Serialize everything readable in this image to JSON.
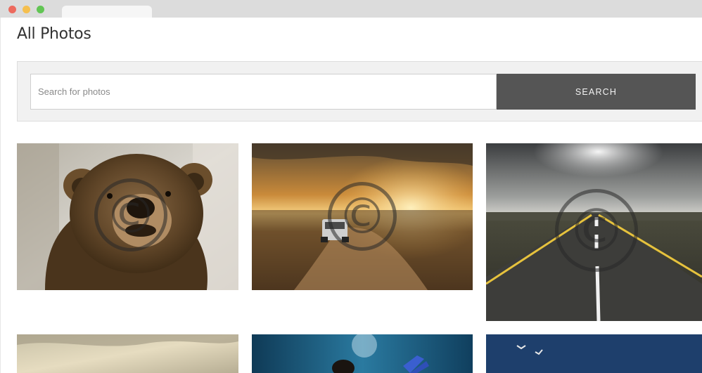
{
  "page": {
    "title": "All Photos"
  },
  "search": {
    "placeholder": "Search for photos",
    "value": "",
    "button_label": "SEARCH"
  },
  "photos": [
    {
      "subject": "brown bear",
      "watermark": "copyright-icon"
    },
    {
      "subject": "car on desert road at sunset",
      "watermark": "copyright-icon"
    },
    {
      "subject": "empty highway under cloudy sky",
      "watermark": "copyright-icon"
    },
    {
      "subject": "cloudy sky",
      "watermark": ""
    },
    {
      "subject": "diver underwater",
      "watermark": ""
    },
    {
      "subject": "seagulls over ocean",
      "watermark": ""
    }
  ],
  "window": {
    "controls": [
      "close-button",
      "minimize-button",
      "maximize-button"
    ]
  }
}
